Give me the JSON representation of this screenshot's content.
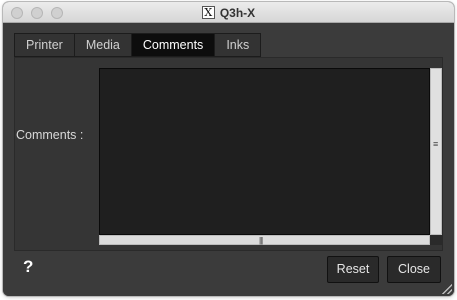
{
  "window": {
    "title": "Q3h-X",
    "title_icon": "x11-icon"
  },
  "tabs": [
    {
      "label": "Printer",
      "active": false
    },
    {
      "label": "Media",
      "active": false
    },
    {
      "label": "Comments",
      "active": true
    },
    {
      "label": "Inks",
      "active": false
    }
  ],
  "comments": {
    "label": "Comments :",
    "value": ""
  },
  "footer": {
    "help_label": "?",
    "reset_label": "Reset",
    "close_label": "Close"
  },
  "colors": {
    "background": "#3b3b3b",
    "active_tab": "#0d0d0d",
    "textarea": "#1f1f1f"
  }
}
